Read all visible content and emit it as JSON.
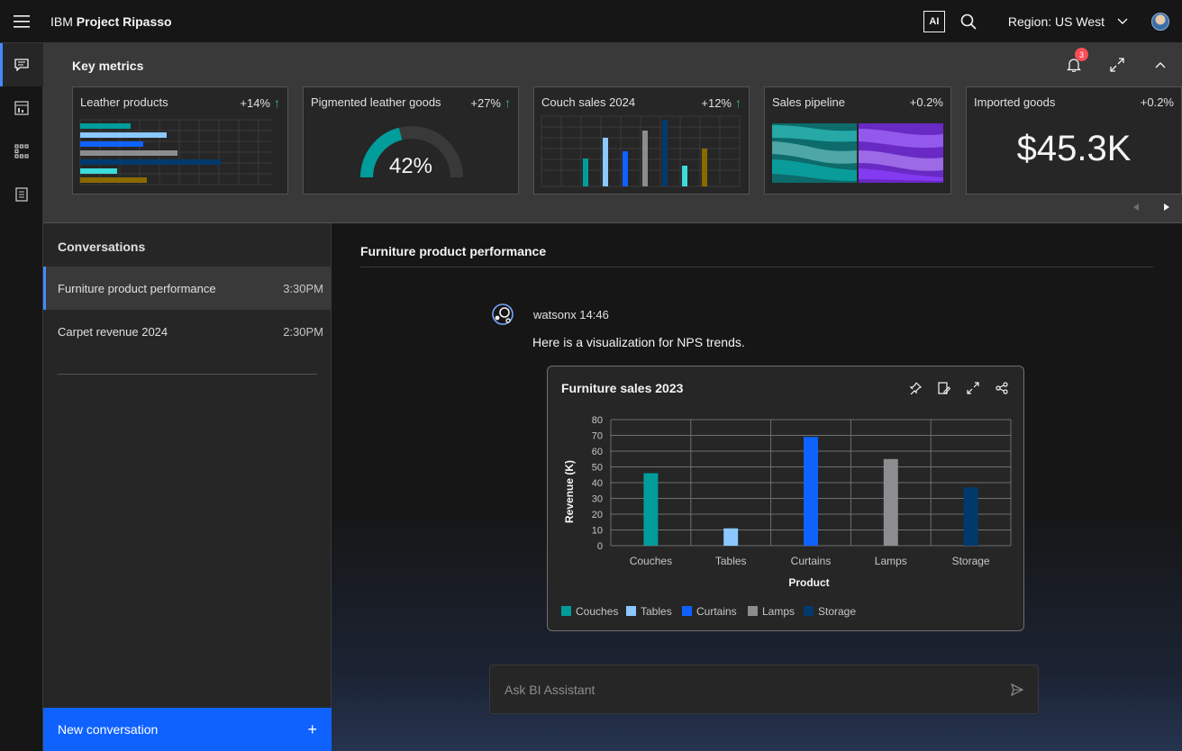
{
  "header": {
    "brand_prefix": "IBM",
    "brand_name": "Project Ripasso",
    "ai_label": "AI",
    "region_label": "Region: US West"
  },
  "rail": {
    "items": [
      {
        "icon": "chat-icon",
        "active": true
      },
      {
        "icon": "dashboard-icon",
        "active": false
      },
      {
        "icon": "apps-icon",
        "active": false
      },
      {
        "icon": "notebook-icon",
        "active": false
      }
    ]
  },
  "metrics": {
    "title": "Key metrics",
    "notification_count": "3",
    "cards": [
      {
        "title": "Leather products",
        "delta": "+14%",
        "trend": "up",
        "viz": "horizontal-bar"
      },
      {
        "title": "Pigmented leather goods",
        "delta": "+27%",
        "trend": "up",
        "viz": "gauge",
        "gauge_value": "42%",
        "gauge_fraction": 0.42
      },
      {
        "title": "Couch sales 2024",
        "delta": "+12%",
        "trend": "up",
        "viz": "vertical-bar"
      },
      {
        "title": "Sales pipeline",
        "delta": "+0.2%",
        "trend": "none",
        "viz": "alluvial"
      },
      {
        "title": "Imported goods",
        "delta": "+0.2%",
        "trend": "none",
        "viz": "kpi",
        "value": "$45.3K"
      }
    ]
  },
  "conversations": {
    "title": "Conversations",
    "items": [
      {
        "label": "Furniture product performance",
        "time": "3:30PM",
        "active": true
      },
      {
        "label": "Carpet revenue 2024",
        "time": "2:30PM",
        "active": false
      }
    ],
    "new_button": "New conversation"
  },
  "chat": {
    "title": "Furniture product performance",
    "message_meta": "watsonx 14:46",
    "message_text": "Here is a visualization for NPS trends.",
    "input_placeholder": "Ask BI Assistant"
  },
  "colors": {
    "teal": "#009d9a",
    "light_blue": "#8ac8ff",
    "blue": "#0f62fe",
    "gray": "#8d8d8f",
    "navy": "#003a6d",
    "primary": "#0f62fe",
    "active_accent": "#4589ff"
  },
  "chart_data": {
    "type": "bar",
    "title": "Furniture sales 2023",
    "xlabel": "Product",
    "ylabel": "Revenue (K)",
    "categories": [
      "Couches",
      "Tables",
      "Curtains",
      "Lamps",
      "Storage"
    ],
    "values": [
      46,
      11,
      69,
      55,
      37
    ],
    "colors": [
      "#009d9a",
      "#8ac8ff",
      "#0f62fe",
      "#8d8d8f",
      "#003a6d"
    ],
    "ylim": [
      0,
      80
    ],
    "yticks": [
      0,
      10,
      20,
      30,
      40,
      50,
      60,
      70,
      80
    ],
    "grid": true,
    "legend": [
      "Couches",
      "Tables",
      "Curtains",
      "Lamps",
      "Storage"
    ],
    "legend_position": "bottom-left"
  }
}
